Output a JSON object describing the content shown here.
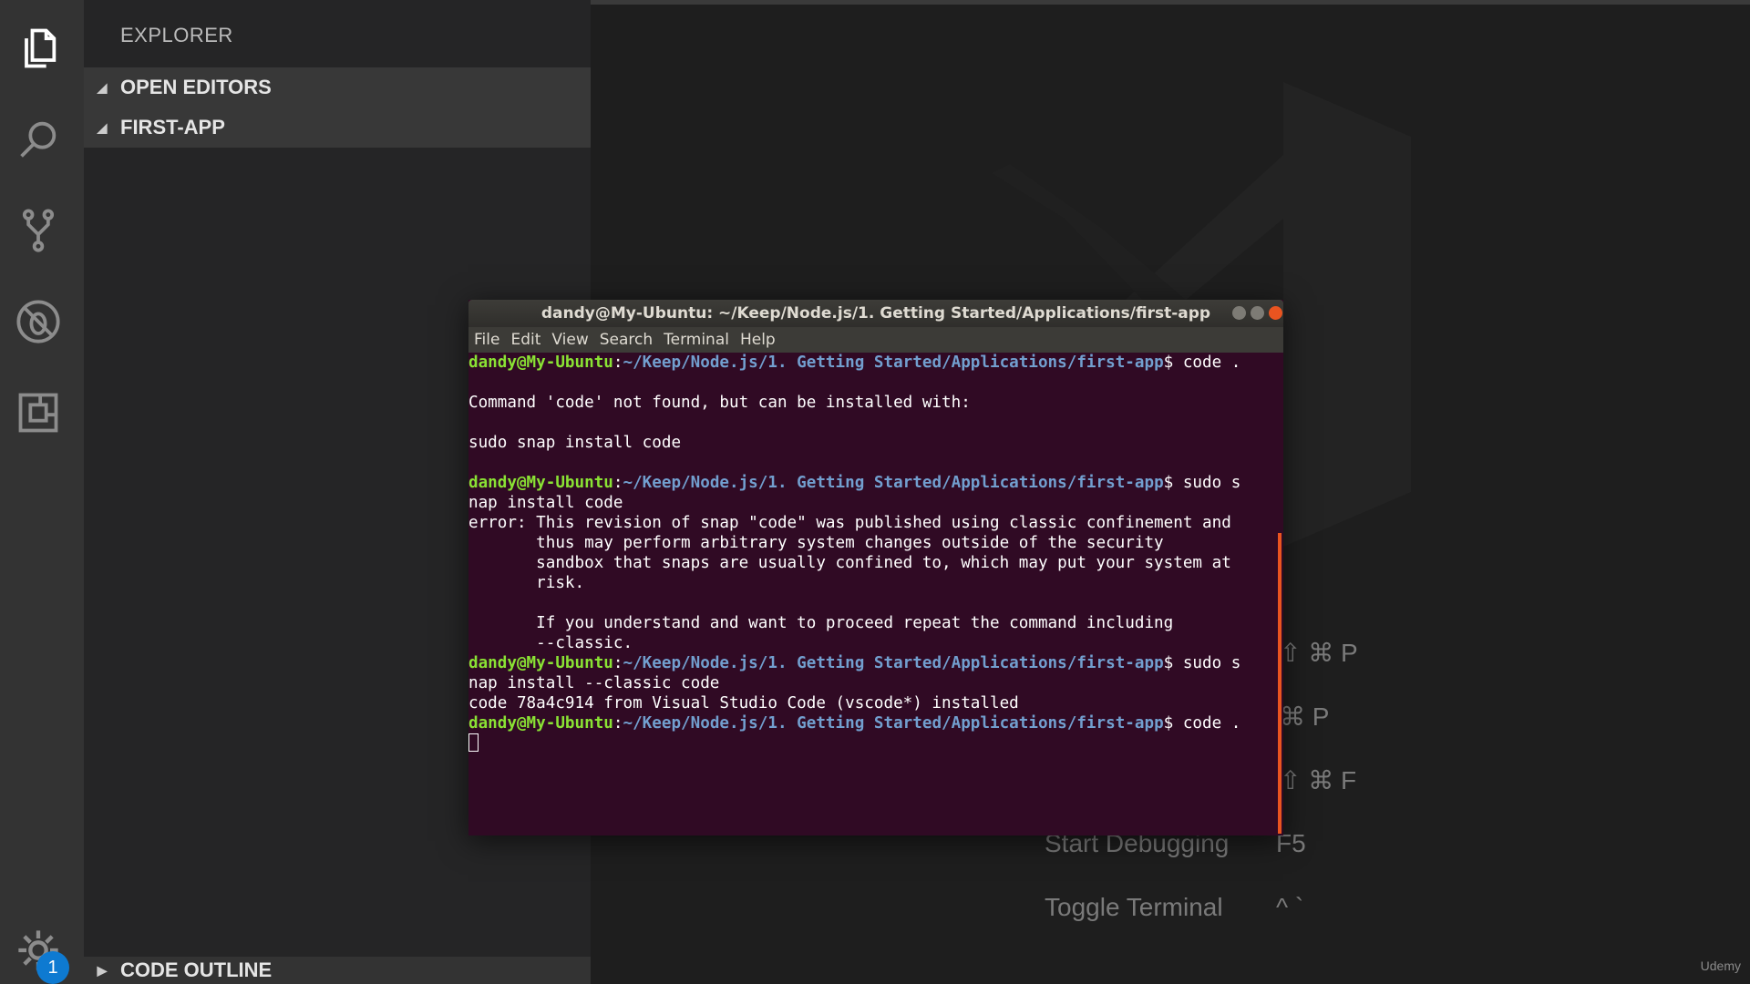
{
  "sidebar": {
    "title": "EXPLORER",
    "sections": [
      "OPEN EDITORS",
      "FIRST-APP"
    ],
    "outline": "CODE OUTLINE"
  },
  "activity": {
    "badge": "1"
  },
  "editor": {
    "shortcuts": [
      {
        "label": "",
        "keys": "⇧ ⌘ P"
      },
      {
        "label": "",
        "keys": "⌘ P"
      },
      {
        "label": "",
        "keys": "⇧ ⌘ F"
      },
      {
        "label": "Start Debugging",
        "keys": "F5"
      },
      {
        "label": "Toggle Terminal",
        "keys": "^ `"
      }
    ],
    "watermark": "Udemy"
  },
  "terminal": {
    "title": "dandy@My-Ubuntu: ~/Keep/Node.js/1. Getting Started/Applications/first-app",
    "menu": [
      "File",
      "Edit",
      "View",
      "Search",
      "Terminal",
      "Help"
    ],
    "user": "dandy@My-Ubuntu",
    "path": "~/Keep/Node.js/1. Getting Started/Applications/first-app",
    "lines": [
      {
        "prompt": true,
        "cmd": "$ code ."
      },
      {
        "text": ""
      },
      {
        "text": "Command 'code' not found, but can be installed with:"
      },
      {
        "text": ""
      },
      {
        "text": "sudo snap install code"
      },
      {
        "text": ""
      },
      {
        "prompt": true,
        "cmd": "$ sudo s"
      },
      {
        "text": "nap install code"
      },
      {
        "text": "error: This revision of snap \"code\" was published using classic confinement and"
      },
      {
        "text": "       thus may perform arbitrary system changes outside of the security"
      },
      {
        "text": "       sandbox that snaps are usually confined to, which may put your system at"
      },
      {
        "text": "       risk."
      },
      {
        "text": ""
      },
      {
        "text": "       If you understand and want to proceed repeat the command including"
      },
      {
        "text": "       --classic."
      },
      {
        "prompt": true,
        "cmd": "$ sudo s"
      },
      {
        "text": "nap install --classic code"
      },
      {
        "text": "code 78a4c914 from Visual Studio Code (vscode*) installed"
      },
      {
        "prompt": true,
        "cmd": "$ code ."
      }
    ]
  },
  "colors": {
    "terminal_bg": "#300a24",
    "prompt_user": "#8ae234",
    "prompt_path": "#729fcf",
    "accent_scrollbar": "#e95420",
    "badge": "#0e7ad1"
  }
}
